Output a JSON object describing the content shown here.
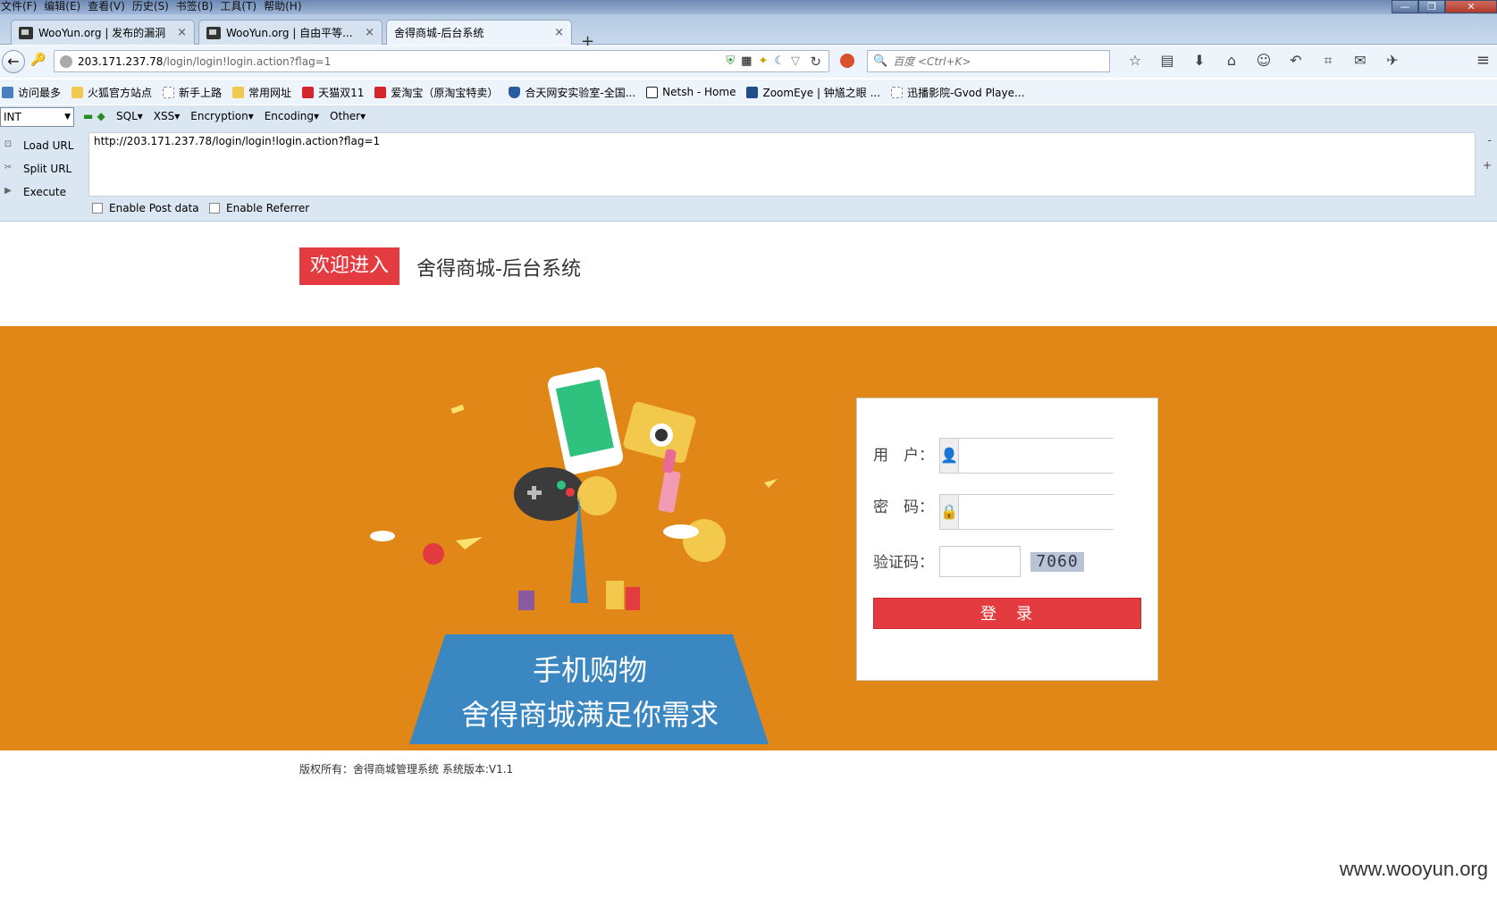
{
  "menubar": [
    "文件(F)",
    "编辑(E)",
    "查看(V)",
    "历史(S)",
    "书签(B)",
    "工具(T)",
    "帮助(H)"
  ],
  "window_controls": {
    "minimize": "—",
    "restore": "❐",
    "close": "✕"
  },
  "tabs": [
    {
      "title": "WooYun.org | 发布的漏洞",
      "close": "×"
    },
    {
      "title": "WooYun.org | 自由平等...",
      "close": "×"
    },
    {
      "title": "舍得商城-后台系统",
      "close": "×"
    }
  ],
  "new_tab": "+",
  "navbar": {
    "url_host": "203.171.237.78",
    "url_path": "/login/login!login.action?flag=1",
    "search_placeholder": "百度 <Ctrl+K>"
  },
  "bookmarks": [
    {
      "label": "访问最多",
      "color": "#4a7fc0"
    },
    {
      "label": "火狐官方站点",
      "color": "#f2c94c"
    },
    {
      "label": "新手上路",
      "color": "#ffffff"
    },
    {
      "label": "常用网址",
      "color": "#f2c94c"
    },
    {
      "label": "天猫双11",
      "color": "#d6262d"
    },
    {
      "label": "爱淘宝（原淘宝特卖）",
      "color": "#d6262d"
    },
    {
      "label": "合天网安实验室-全国...",
      "color": "#2a5c9e"
    },
    {
      "label": "Netsh - Home",
      "color": "#222222"
    },
    {
      "label": "ZoomEye | 钟馗之眼 ...",
      "color": "#1f4f8a"
    },
    {
      "label": "迅播影院-Gvod Playe...",
      "color": "#ffffff"
    }
  ],
  "hackbar": {
    "select_value": "INT",
    "menus": [
      "SQL▾",
      "XSS▾",
      "Encryption▾",
      "Encoding▾",
      "Other▾"
    ],
    "buttons": [
      "Load URL",
      "Split URL",
      "Execute"
    ],
    "url_text": "http://203.171.237.78/login/login!login.action?flag=1",
    "enable_post": "Enable Post data",
    "enable_referrer": "Enable Referrer",
    "minus": "-",
    "plus": "+"
  },
  "page": {
    "welcome": "欢迎进入",
    "title": "舍得商城-后台系统",
    "banner_line1": "手机购物",
    "banner_line2": "舍得商城满足你需求",
    "login": {
      "user_label": "用　户：",
      "password_label": "密　码：",
      "captcha_label": "验证码：",
      "captcha_value": "7060",
      "submit": "登　录"
    },
    "footer": "版权所有：舍得商城管理系统 系统版本:V1.1"
  },
  "watermark": "www.wooyun.org",
  "colors": {
    "banner": "#e08717",
    "accent_red": "#e33b3f",
    "banner_blue": "#3a87c2"
  }
}
